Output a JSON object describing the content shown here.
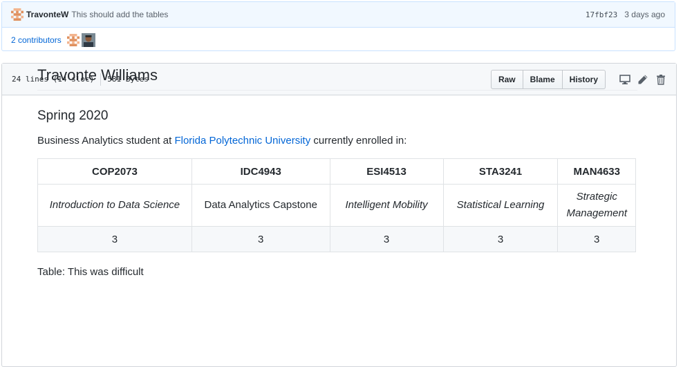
{
  "commit": {
    "author": "TravonteW",
    "message": "This should add the tables",
    "sha": "17fbf23",
    "age": "3 days ago",
    "contributors_label": "2 contributors"
  },
  "file": {
    "lines": "24 lines (14 sloc)",
    "size": "581 Bytes",
    "buttons": {
      "raw": "Raw",
      "blame": "Blame",
      "history": "History"
    },
    "icons": [
      "desktop-icon",
      "pencil-icon",
      "trash-icon"
    ]
  },
  "readme": {
    "title": "Travonte Williams",
    "subtitle": "Spring 2020",
    "intro_before": "Business Analytics student at ",
    "intro_link": "Florida Polytechnic University",
    "intro_after": " currently enrolled in:",
    "table": {
      "headers": [
        "COP2073",
        "IDC4943",
        "ESI4513",
        "STA3241",
        "MAN4633"
      ],
      "names": [
        "Introduction to Data Science",
        "Data Analytics Capstone",
        "Intelligent Mobility",
        "Statistical Learning",
        "Strategic Management"
      ],
      "credits": [
        "3",
        "3",
        "3",
        "3",
        "3"
      ]
    },
    "caption": "Table: This was difficult"
  },
  "colors": {
    "link": "#0366d6",
    "commit_bg": "#f1f8ff",
    "header_bg": "#f6f8fa",
    "identicon": "#e0915f"
  }
}
